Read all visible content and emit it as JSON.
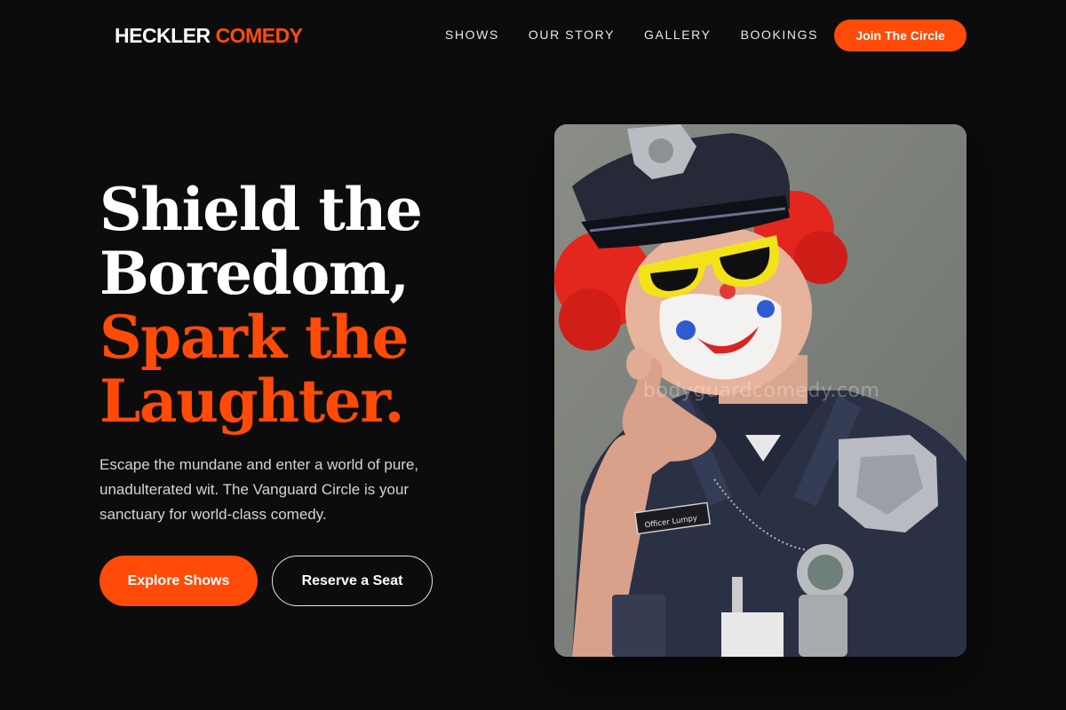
{
  "brand": {
    "word1": "HECKLER",
    "word2": "COMEDY"
  },
  "nav": {
    "items": [
      {
        "label": "SHOWS"
      },
      {
        "label": "OUR STORY"
      },
      {
        "label": "GALLERY"
      },
      {
        "label": "BOOKINGS"
      }
    ],
    "cta_label": "Join The Circle"
  },
  "hero": {
    "headline_white_1": "Shield the",
    "headline_white_2": "Boredom,",
    "headline_orange_1": "Spark the",
    "headline_orange_2": "Laughter.",
    "lede": "Escape the mundane and enter a world of pure, unadulterated wit. The Vanguard Circle is your sanctuary for world-class comedy.",
    "primary_button": "Explore Shows",
    "secondary_button": "Reserve a Seat"
  },
  "photo": {
    "watermark": "bodyguardcomedy.com",
    "name_tag": "Officer Lumpy"
  },
  "colors": {
    "accent": "#ff4a08",
    "background": "#0c0c0c",
    "text": "#ffffff"
  }
}
